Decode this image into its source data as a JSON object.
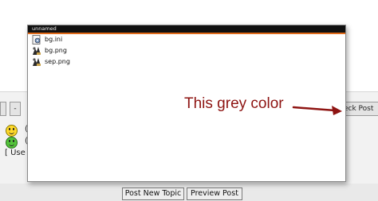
{
  "toolbar": {
    "btn_a": "",
    "btn_b": "-",
    "check_post_label": "eck Post"
  },
  "smilies": {
    "row1_text": "(",
    "row2_text": "(",
    "use_text": "[ Use"
  },
  "form": {
    "post_new_topic_label": "Post New Topic",
    "preview_post_label": "Preview Post"
  },
  "dialog": {
    "title": "unnamed",
    "files": [
      {
        "name": "bg.ini",
        "icon": "settings-file-icon"
      },
      {
        "name": "bg.png",
        "icon": "image-file-icon"
      },
      {
        "name": "sep.png",
        "icon": "image-file-icon"
      }
    ]
  },
  "annotation": {
    "text": "This grey color",
    "color": "#8e1412"
  },
  "colors": {
    "titlebar": "#101010",
    "titlebar_accent": "#e06a1a",
    "band_grey": "#f2f2f2"
  }
}
